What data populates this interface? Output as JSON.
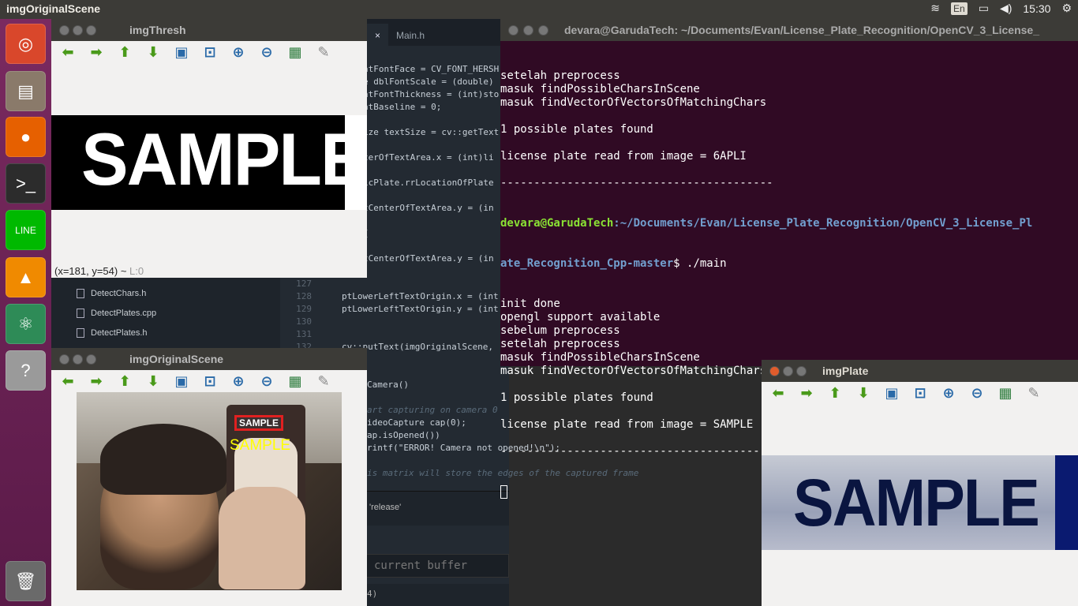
{
  "topbar": {
    "title": "imgOriginalScene",
    "lang": "En",
    "clock": "15:30"
  },
  "launcher": {
    "items": [
      {
        "name": "ubuntu-icon",
        "glyph": "◎",
        "color": "#d9472b"
      },
      {
        "name": "files-icon",
        "glyph": "▤",
        "color": "#8a7a6a"
      },
      {
        "name": "firefox-icon",
        "glyph": "●",
        "color": "#e66000"
      },
      {
        "name": "terminal-icon",
        "glyph": ">_",
        "color": "#2c2c2c"
      },
      {
        "name": "line-icon",
        "glyph": "LINE",
        "color": "#00b900"
      },
      {
        "name": "vlc-icon",
        "glyph": "▲",
        "color": "#f08a00"
      },
      {
        "name": "atom-icon",
        "glyph": "⚛",
        "color": "#2e8b57"
      },
      {
        "name": "help-icon",
        "glyph": "?",
        "color": "#9a9a9a"
      },
      {
        "name": "trash-icon",
        "glyph": "🗑",
        "color": "#6a6a6a"
      }
    ]
  },
  "editor": {
    "tab_close": "×",
    "tab_label": "Main.h",
    "lines": [
      {
        "no": "",
        "code": "ntFontFace = CV_FONT_HERSH"
      },
      {
        "no": "",
        "code": "e dblFontScale = (double)"
      },
      {
        "no": "",
        "code": "ntFontThickness = (int)sto"
      },
      {
        "no": "",
        "code": "ntBaseline = 0;"
      },
      {
        "no": "",
        "code": "ize textSize = cv::getText"
      },
      {
        "no": "",
        "code": "terOfTextArea.x = (int)li"
      },
      {
        "no": "",
        "code": "icPlate.rrLocationOfPlate"
      },
      {
        "no": "",
        "code": "tCenterOfTextArea.y = (in"
      },
      {
        "no": "",
        "code": "{"
      },
      {
        "no": "",
        "code": "tCenterOfTextArea.y = (in"
      },
      {
        "no": "127",
        "code": ""
      },
      {
        "no": "128",
        "code": "ptLowerLeftTextOrigin.x = (int"
      },
      {
        "no": "129",
        "code": "ptLowerLeftTextOrigin.y = (int"
      },
      {
        "no": "130",
        "code": ""
      },
      {
        "no": "131",
        "code": ""
      },
      {
        "no": "132",
        "code": "cv::putText(imgOriginalScene,"
      },
      {
        "no": "",
        "code": "Camera()"
      },
      {
        "no": "",
        "code": "art capturing on camera 0"
      },
      {
        "no": "",
        "code": "ideoCapture cap(0);"
      },
      {
        "no": "",
        "code": "ap.isOpened())"
      },
      {
        "no": "",
        "code": "rintf(\"ERROR! Camera not opened!\\n\");"
      },
      {
        "no": "",
        "code": "is matrix will store the edges of the captured frame"
      }
    ],
    "panel_release": "'release'",
    "panel_buffer": "current buffer",
    "panel_status": "4)"
  },
  "filetree": {
    "files": [
      "DetectChars.h",
      "DetectPlates.cpp",
      "DetectPlates.h"
    ]
  },
  "terminal": {
    "title": "devara@GarudaTech: ~/Documents/Evan/License_Plate_Recognition/OpenCV_3_License_",
    "lines_before": [
      "setelah preprocess",
      "masuk findPossibleCharsInScene",
      "masuk findVectorOfVectorsOfMatchingChars",
      "",
      "1 possible plates found",
      "",
      "license plate read from image = 6APLI",
      "",
      "-----------------------------------------"
    ],
    "prompt_user": "devara@GarudaTech",
    "prompt_path": ":~/Documents/Evan/License_Plate_Recognition/OpenCV_3_License_Pl",
    "prompt_path2": "ate_Recognition_Cpp-master",
    "prompt_cmd": "$ ./main",
    "lines_after": [
      "init done",
      "opengl support available",
      "sebelum preprocess",
      "setelah preprocess",
      "masuk findPossibleCharsInScene",
      "masuk findVectorOfVectorsOfMatchingChars",
      "",
      "1 possible plates found",
      "",
      "license plate read from image = SAMPLE",
      "",
      "-----------------------------------------"
    ]
  },
  "imgThresh": {
    "title": "imgThresh",
    "plate_text": "SAMPLE",
    "status": "(x=181, y=54) ~",
    "status_dim": "L:0"
  },
  "imgOriginal": {
    "title": "imgOriginalScene",
    "plate_label": "SAMPLE",
    "overlay_text": "SAMPLE"
  },
  "imgPlate": {
    "title": "imgPlate",
    "plate_text": "SAMPLE"
  },
  "toolbar_icons": [
    {
      "name": "pan-left-icon",
      "glyph": "⬅",
      "cls": ""
    },
    {
      "name": "pan-right-icon",
      "glyph": "➡",
      "cls": ""
    },
    {
      "name": "pan-up-icon",
      "glyph": "⬆",
      "cls": ""
    },
    {
      "name": "pan-down-icon",
      "glyph": "⬇",
      "cls": ""
    },
    {
      "name": "zoom-original-icon",
      "glyph": "▣",
      "cls": "blue"
    },
    {
      "name": "zoom-fit-icon",
      "glyph": "⊡",
      "cls": "blue"
    },
    {
      "name": "zoom-in-icon",
      "glyph": "⊕",
      "cls": "blue"
    },
    {
      "name": "zoom-out-icon",
      "glyph": "⊖",
      "cls": "blue"
    },
    {
      "name": "save-icon",
      "glyph": "▦",
      "cls": "dark"
    },
    {
      "name": "properties-icon",
      "glyph": "✎",
      "cls": "grey"
    }
  ]
}
